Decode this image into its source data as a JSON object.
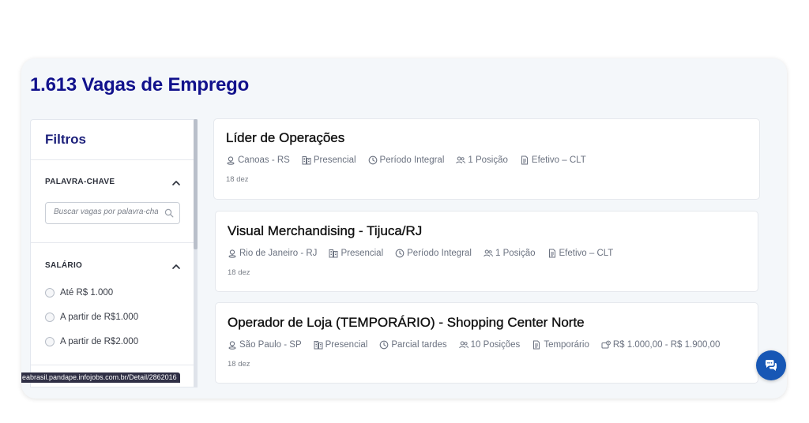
{
  "page": {
    "title": "1.613 Vagas de Emprego"
  },
  "filters": {
    "title": "Filtros",
    "keyword": {
      "label": "PALAVRA-CHAVE",
      "placeholder": "Buscar vagas por palavra-chave"
    },
    "salary": {
      "label": "SALÁRIO",
      "options": [
        "Até R$ 1.000",
        "A partir de R$1.000",
        "A partir de R$2.000"
      ]
    }
  },
  "status_bar": {
    "url": "eabrasil.pandape.infojobs.com.br/Detail/2862016"
  },
  "jobs": [
    {
      "title": "Líder de Operações",
      "location": "Canoas - RS",
      "mode": "Presencial",
      "schedule": "Período Integral",
      "positions": "1 Posição",
      "contract": "Efetivo – CLT",
      "salary": "",
      "date": "18 dez"
    },
    {
      "title": "Visual Merchandising - Tijuca/RJ",
      "location": "Rio de Janeiro - RJ",
      "mode": "Presencial",
      "schedule": "Período Integral",
      "positions": "1 Posição",
      "contract": "Efetivo – CLT",
      "salary": "",
      "date": "18 dez"
    },
    {
      "title": "Operador de Loja (TEMPORÁRIO) - Shopping Center Norte",
      "location": "São Paulo - SP",
      "mode": "Presencial",
      "schedule": "Parcial tardes",
      "positions": "10 Posições",
      "contract": "Temporário",
      "salary": "R$ 1.000,00 - R$ 1.900,00",
      "date": "18 dez"
    }
  ],
  "icons": {
    "location": "map-pin-icon",
    "mode": "building-icon",
    "schedule": "clock-icon",
    "positions": "people-icon",
    "contract": "document-icon",
    "salary": "money-icon",
    "chat": "chat-icon"
  },
  "colors": {
    "title": "#11118c",
    "accent": "#1757b5",
    "text_muted": "#6b7280"
  }
}
